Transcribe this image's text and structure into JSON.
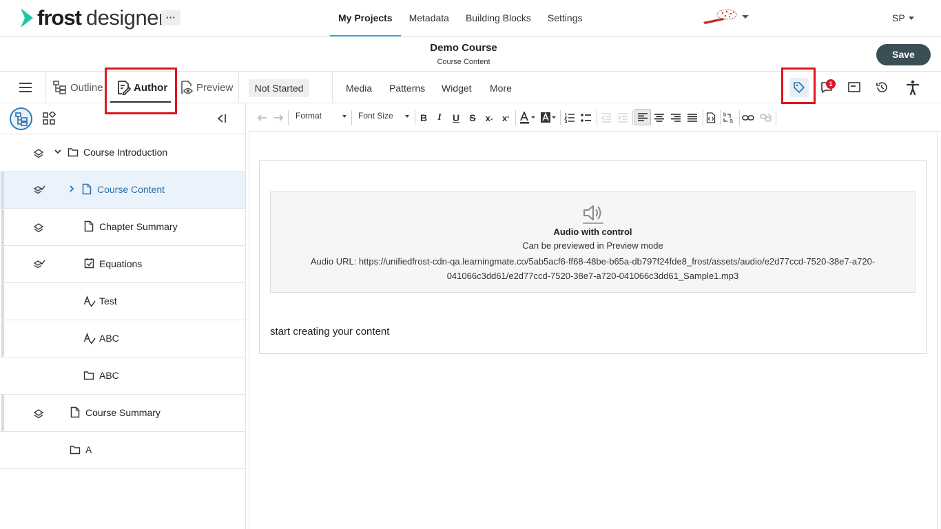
{
  "brand": {
    "name_bold": "frost",
    "name_light": "designer",
    "accent": "#1ec7a6"
  },
  "topnav": {
    "more": "···",
    "items": [
      "My Projects",
      "Metadata",
      "Building Blocks",
      "Settings"
    ],
    "active": "My Projects"
  },
  "user": {
    "initials": "SP"
  },
  "course": {
    "title": "Demo Course",
    "subtitle": "Course Content",
    "save_label": "Save"
  },
  "modes": {
    "outline": "Outline",
    "author": "Author",
    "preview": "Preview"
  },
  "status": "Not Started",
  "insert_menu": [
    "Media",
    "Patterns",
    "Widget",
    "More"
  ],
  "right_tools": [
    {
      "icon": "tag-icon",
      "highlighted": true
    },
    {
      "icon": "comment-icon",
      "badge": "1"
    },
    {
      "icon": "panel-icon"
    },
    {
      "icon": "history-icon"
    },
    {
      "icon": "accessibility-icon"
    }
  ],
  "tree": [
    {
      "label": "Course Introduction",
      "type": "folder",
      "expanded": true,
      "level": 0,
      "bar": false
    },
    {
      "label": "Course Content",
      "type": "page",
      "selected": true,
      "level": 1,
      "bar": true
    },
    {
      "label": "Chapter Summary",
      "type": "page",
      "level": 1,
      "bar": true
    },
    {
      "label": "Equations",
      "type": "checkpage",
      "level": 1,
      "bar": true
    },
    {
      "label": "Test",
      "type": "assessment",
      "level": 1,
      "bar": true
    },
    {
      "label": "ABC",
      "type": "assessment",
      "level": 1,
      "bar": true
    },
    {
      "label": "ABC",
      "type": "folder",
      "level": 1,
      "bar": false
    },
    {
      "label": "Course Summary",
      "type": "page",
      "level": 0,
      "bar": true
    },
    {
      "label": "A",
      "type": "folder",
      "level": 0,
      "bar": false
    }
  ],
  "editor_toolbar": {
    "format_label": "Format",
    "fontsize_label": "Font Size"
  },
  "audio": {
    "title": "Audio with control",
    "subtitle": "Can be previewed in Preview mode",
    "url_text": "Audio URL: https://unifiedfrost-cdn-qa.learningmate.co/5ab5acf6-ff68-48be-b65a-db797f24fde8_frost/assets/audio/e2d77ccd-7520-38e7-a720-041066c3dd61/e2d77ccd-7520-38e7-a720-041066c3dd61_Sample1.mp3"
  },
  "placeholder": "start creating your content"
}
